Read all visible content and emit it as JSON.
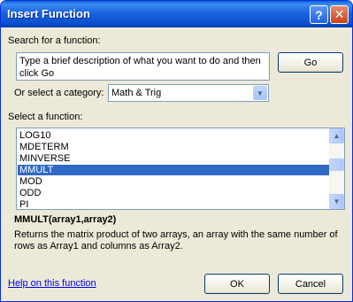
{
  "window": {
    "title": "Insert Function"
  },
  "search": {
    "label": "Search for a function:",
    "value": "Type a brief description of what you want to do and then click Go",
    "go_label": "Go"
  },
  "category": {
    "label": "Or select a category:",
    "value": "Math & Trig"
  },
  "functions": {
    "label": "Select a function:",
    "items": [
      "LOG10",
      "MDETERM",
      "MINVERSE",
      "MMULT",
      "MOD",
      "ODD",
      "PI"
    ],
    "selected": "MMULT"
  },
  "details": {
    "signature": "MMULT(array1,array2)",
    "description": "Returns the matrix product of two arrays, an array with the same number of rows as Array1 and columns as Array2."
  },
  "footer": {
    "help_link": "Help on this function",
    "ok_label": "OK",
    "cancel_label": "Cancel"
  },
  "icons": {
    "help": "help-icon",
    "close": "close-icon",
    "dropdown": "chevron-down-icon",
    "scroll_up": "arrow-up-icon",
    "scroll_down": "arrow-down-icon"
  }
}
